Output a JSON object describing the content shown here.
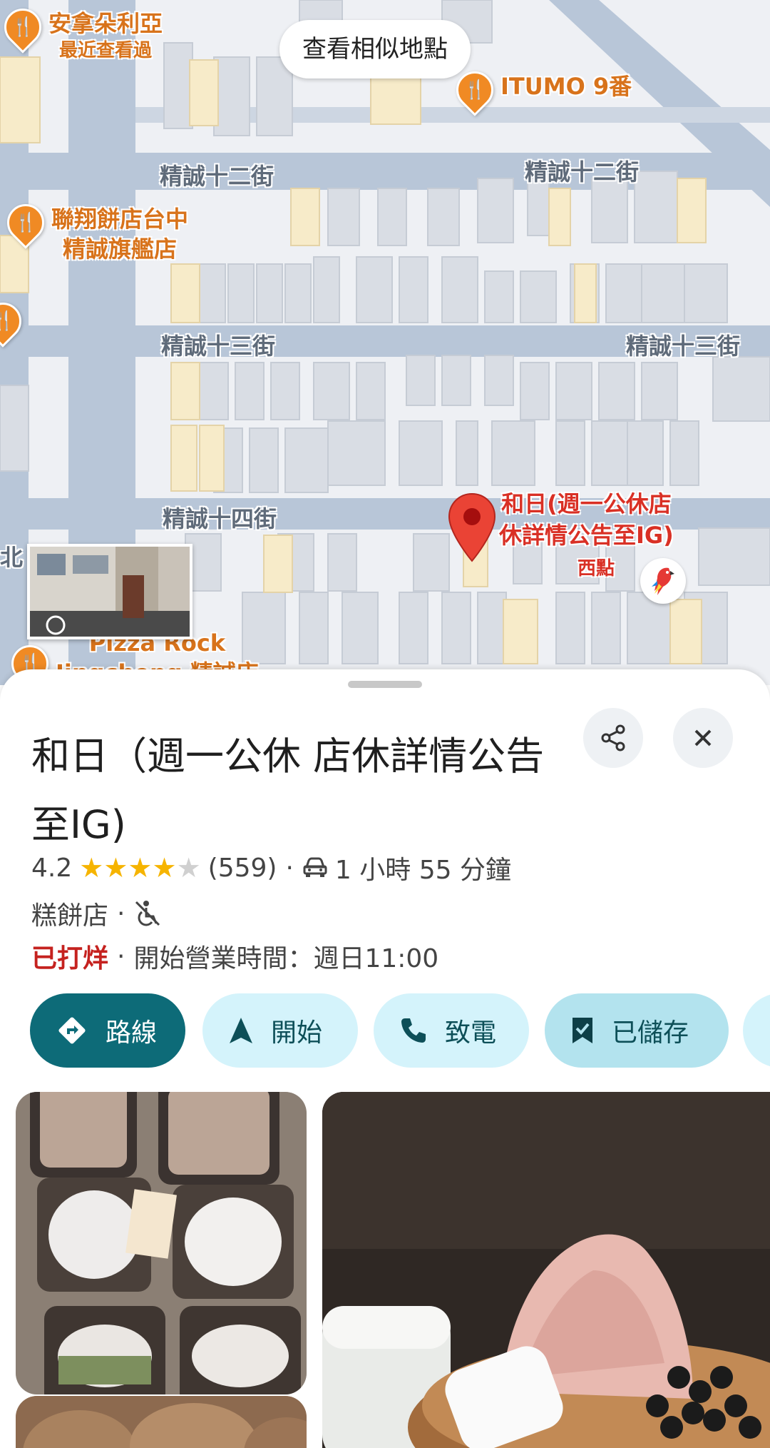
{
  "map": {
    "similar_button": "查看相似地點",
    "streets": [
      "精誠十二街",
      "精誠十二街",
      "精誠十三街",
      "精誠十三街",
      "精誠十四街"
    ],
    "pois": [
      {
        "name": "安拿朵利亞",
        "sub": "最近查看過",
        "icon": "restaurant-icon"
      },
      {
        "name": "ITUMO 9番",
        "sub": "",
        "icon": "restaurant-icon"
      },
      {
        "name": "聯翔餅店台中",
        "sub": "精誠旗艦店",
        "icon": "restaurant-icon"
      },
      {
        "name": "Pizza Rock",
        "sub": "Jingcheng 精誠店",
        "icon": "restaurant-icon"
      }
    ],
    "selected": {
      "line1": "和日(週一公休店",
      "line2": "休詳情公告至IG)",
      "sub": "西點"
    },
    "edge_label": "北",
    "accent_orange": "#f08a24",
    "accent_red": "#d93025"
  },
  "place": {
    "title": "和日（週一公休 店休詳情公告至IG)",
    "rating": "4.2",
    "stars": 4.2,
    "review_count": "(559)",
    "drive_icon": "car-icon",
    "drive_time": "1 小時 55 分鐘",
    "category": "糕餅店",
    "accessibility_icon": "not-wheelchair-accessible-icon",
    "status": "已打烊",
    "hours_text": "開始營業時間：週日11:00"
  },
  "actions": {
    "directions": "路線",
    "start": "開始",
    "call": "致電",
    "saved": "已儲存"
  },
  "colors": {
    "primary": "#0d6b78",
    "chip": "#d4f3fb",
    "star": "#f6b400",
    "closed": "#c5221f"
  }
}
